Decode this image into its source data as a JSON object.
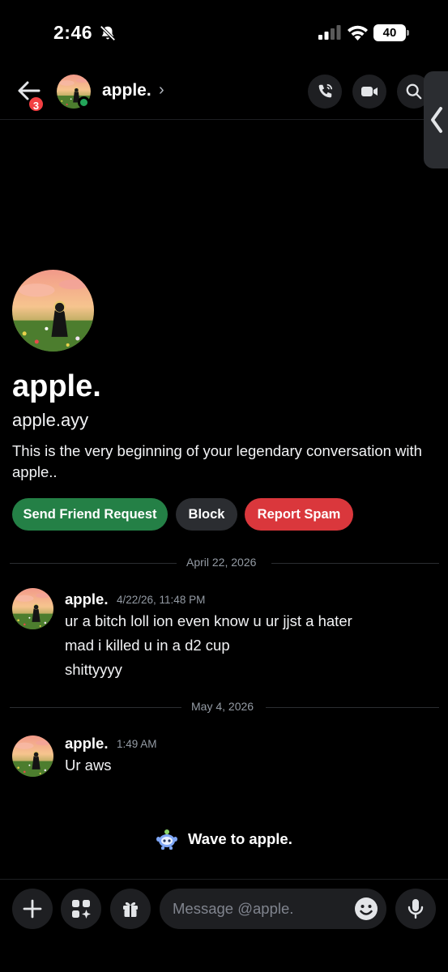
{
  "status_bar": {
    "time": "2:46",
    "battery": "40"
  },
  "header": {
    "name": "apple.",
    "chevron": "›",
    "badge_count": "3"
  },
  "profile": {
    "display_name": "apple.",
    "username": "apple.ayy",
    "intro": "This is the very beginning of your legendary conversation with apple..",
    "buttons": {
      "friend": "Send Friend Request",
      "block": "Block",
      "spam": "Report Spam"
    }
  },
  "dividers": {
    "first": "April 22, 2026",
    "second": "May 4, 2026"
  },
  "messages": [
    {
      "author": "apple.",
      "timestamp": "4/22/26, 11:48 PM",
      "lines": [
        "ur a bitch loll ion even know u ur jjst a hater",
        "mad i killed u in a d2 cup",
        "shittyyyy"
      ]
    },
    {
      "author": "apple.",
      "timestamp": "1:49 AM",
      "lines": [
        "Ur aws"
      ]
    }
  ],
  "wave": {
    "text": "Wave to apple."
  },
  "composer": {
    "placeholder": "Message @apple."
  },
  "icons": [
    "bell-off-icon",
    "signal-icon",
    "wifi-icon",
    "battery-icon",
    "back-arrow-icon",
    "phone-icon",
    "video-icon",
    "search-icon",
    "plus-icon",
    "apps-icon",
    "gift-icon",
    "emoji-icon",
    "microphone-icon",
    "wave-sticker-icon"
  ],
  "colors": {
    "accent_green": "#248046",
    "danger_red": "#da373c",
    "online": "#23a55a",
    "badge": "#f23f42"
  }
}
